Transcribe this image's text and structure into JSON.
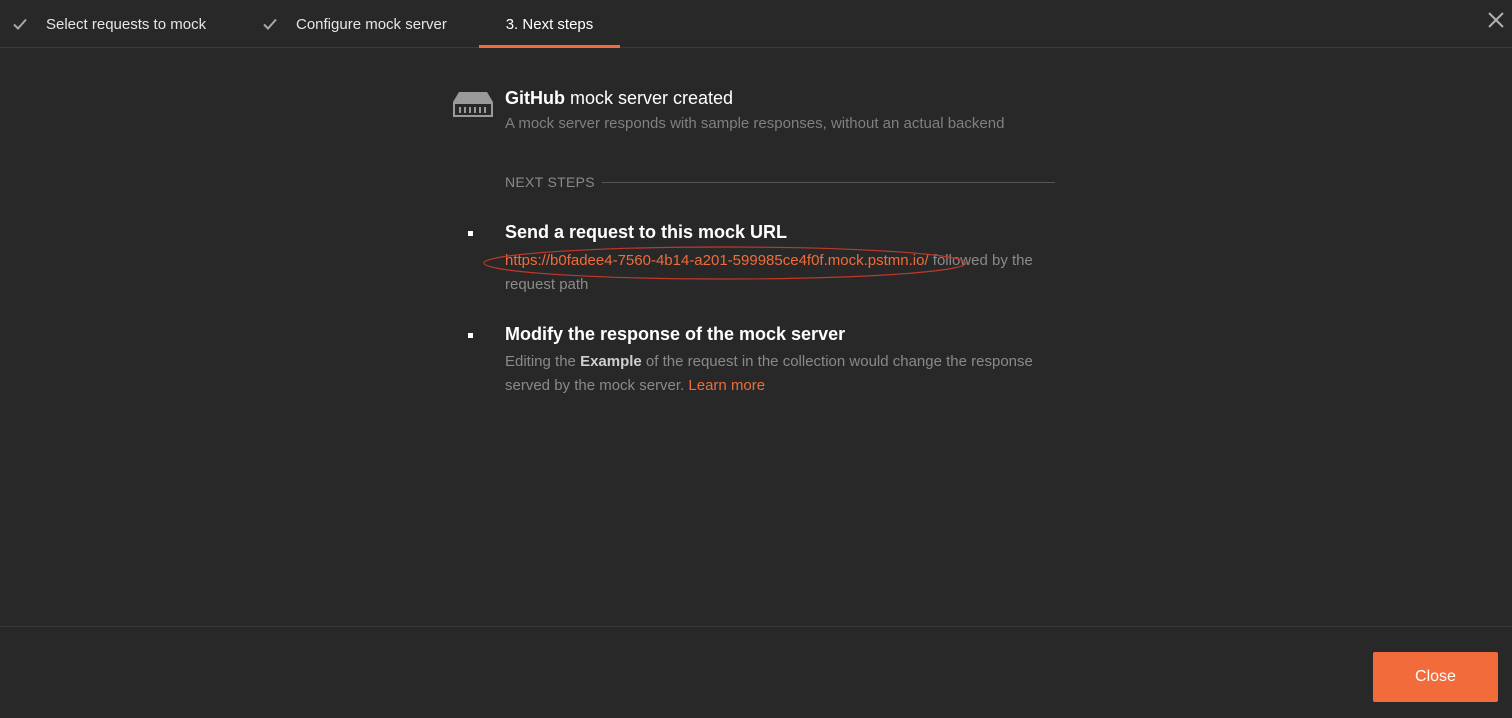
{
  "stepper": {
    "steps": [
      {
        "label": "Select requests to mock",
        "state": "done"
      },
      {
        "label": "Configure mock server",
        "state": "done"
      },
      {
        "label": "3. Next steps",
        "state": "active"
      }
    ]
  },
  "header": {
    "collection_name": "GitHub",
    "title_suffix": " mock server created",
    "subtitle": "A mock server responds with sample responses, without an actual backend"
  },
  "next_steps": {
    "label": "NEXT STEPS",
    "items": [
      {
        "heading": "Send a request to this mock URL",
        "url": "https://b0fadee4-7560-4b14-a201-599985ce4f0f.mock.pstmn.io/",
        "text_after_url": " followed by the request path"
      },
      {
        "heading": "Modify the response of the mock server",
        "text_before": "Editing the ",
        "emphasis": "Example",
        "text_after": " of the request in the collection would change the response served by the mock server. ",
        "link_label": "Learn more"
      }
    ]
  },
  "footer": {
    "close_label": "Close"
  },
  "colors": {
    "accent": "#f26b3a",
    "background": "#282828",
    "annotation": "#c0392b"
  },
  "icons": {
    "check": "check-icon",
    "close": "close-icon",
    "server": "server-icon"
  }
}
